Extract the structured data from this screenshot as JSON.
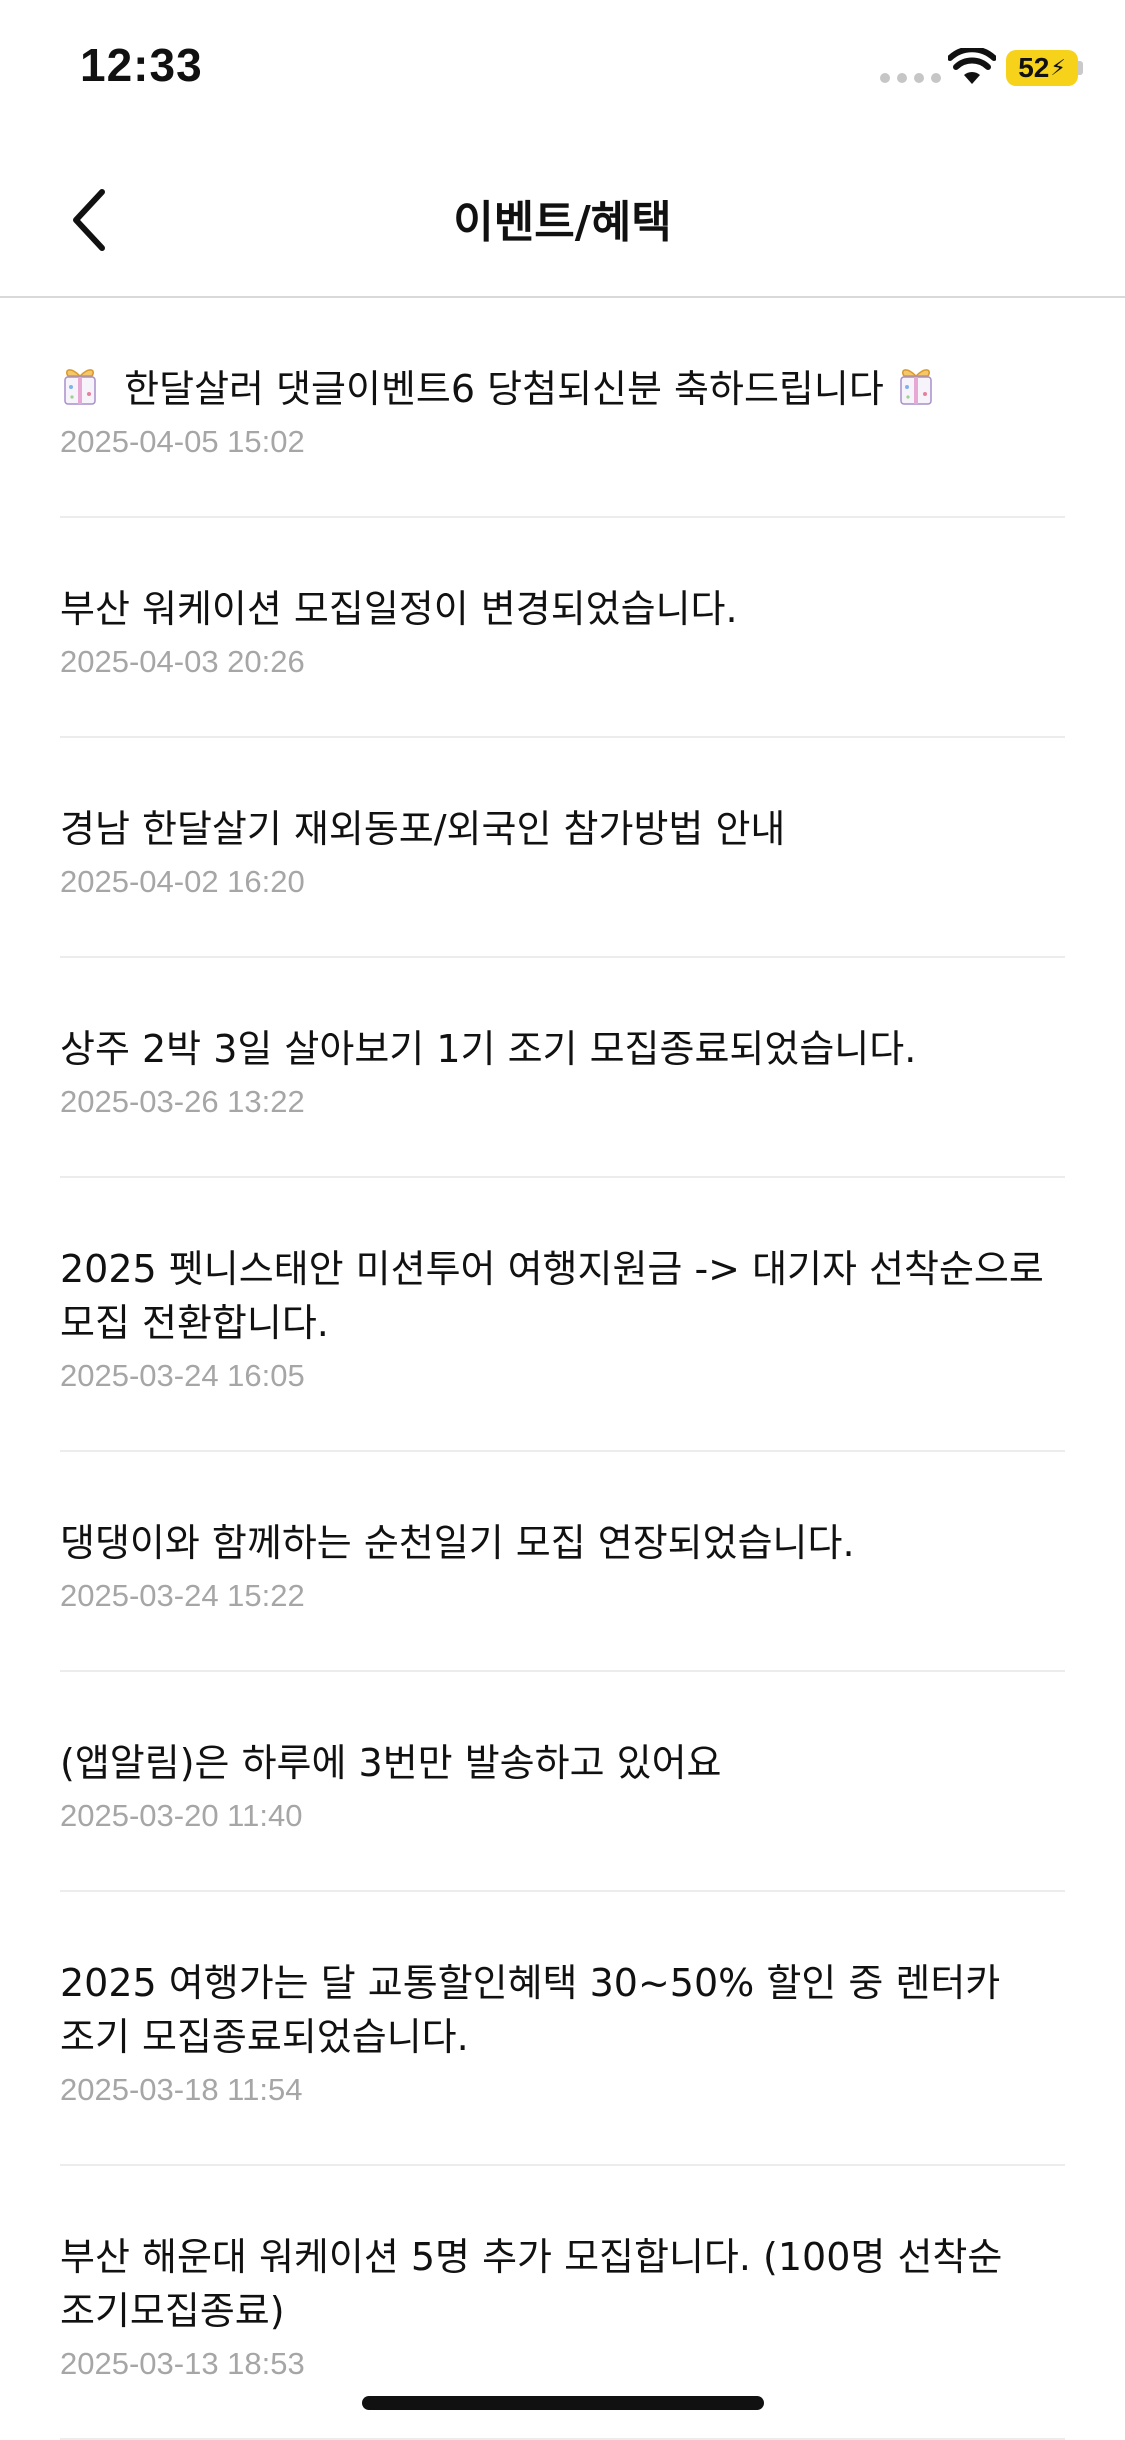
{
  "status_bar": {
    "time": "12:33",
    "battery_level": "52",
    "battery_color": "#f7d21a",
    "icons": [
      "signal-icon",
      "wifi-icon",
      "battery-charging-icon"
    ]
  },
  "header": {
    "title": "이벤트/혜택",
    "back_icon": "chevron-left-icon"
  },
  "notices": [
    {
      "title": "한달살러 댓글이벤트6 당첨되신분 축하드립니다",
      "date": "2025-04-05 15:02",
      "icon": "gift-icon"
    },
    {
      "title": "부산 워케이션 모집일정이 변경되었습니다.",
      "date": "2025-04-03 20:26"
    },
    {
      "title": "경남 한달살기 재외동포/외국인 참가방법 안내",
      "date": "2025-04-02 16:20"
    },
    {
      "title": "상주 2박 3일 살아보기 1기 조기 모집종료되었습니다.",
      "date": "2025-03-26 13:22"
    },
    {
      "title": "2025 펫니스태안 미션투어 여행지원금 -> 대기자 선착순으로 모집 전환합니다.",
      "date": "2025-03-24 16:05"
    },
    {
      "title": "댕댕이와 함께하는 순천일기 모집 연장되었습니다.",
      "date": "2025-03-24 15:22"
    },
    {
      "title": "(앱알림)은 하루에 3번만 발송하고 있어요",
      "date": "2025-03-20 11:40"
    },
    {
      "title": "2025 여행가는 달 교통할인혜택 30~50% 할인 중 렌터카 조기 모집종료되었습니다.",
      "date": "2025-03-18 11:54"
    },
    {
      "title": "부산 해운대 워케이션 5명 추가 모집합니다. (100명 선착순 조기모집종료)",
      "date": "2025-03-13 18:53"
    }
  ]
}
